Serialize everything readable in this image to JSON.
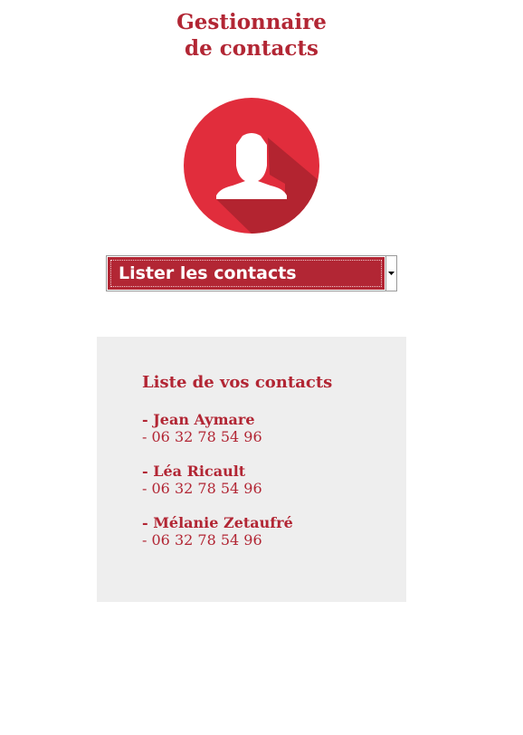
{
  "header": {
    "title_line1": "Gestionnaire",
    "title_line2": "de contacts"
  },
  "avatar": {
    "icon": "user-icon",
    "circle_color": "#e12d3c",
    "shadow_color": "#b32430"
  },
  "action_select": {
    "selected": "Lister les contacts"
  },
  "contacts_panel": {
    "title": "Liste de vos contacts",
    "contacts": [
      {
        "name": "- Jean Aymare",
        "phone": "- 06 32 78 54 96"
      },
      {
        "name": "- Léa Ricault",
        "phone": "- 06 32 78 54 96"
      },
      {
        "name": "- Mélanie Zetaufré",
        "phone": "- 06 32 78 54 96"
      }
    ]
  },
  "colors": {
    "accent": "#b22634",
    "panel_background": "#eeeeee"
  }
}
